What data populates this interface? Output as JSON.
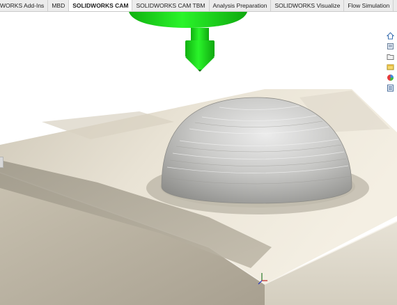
{
  "command_manager": {
    "tabs": [
      {
        "label": "WORKS Add-Ins",
        "active": false
      },
      {
        "label": "MBD",
        "active": false
      },
      {
        "label": "SOLIDWORKS CAM",
        "active": true
      },
      {
        "label": "SOLIDWORKS CAM TBM",
        "active": false
      },
      {
        "label": "Analysis Preparation",
        "active": false
      },
      {
        "label": "SOLIDWORKS Visualize",
        "active": false
      },
      {
        "label": "Flow Simulation",
        "active": false
      }
    ]
  },
  "task_pane": {
    "icons": [
      "home-icon",
      "resources-icon",
      "design-library-icon",
      "file-explorer-icon",
      "appearances-icon",
      "custom-properties-icon"
    ]
  },
  "colors": {
    "tool_green": "#1ee81e",
    "stock_light": "#efe9dc",
    "stock_dark": "#b9b2a1",
    "dome": "#c8c8c8",
    "active_tab": "#ffffff"
  }
}
